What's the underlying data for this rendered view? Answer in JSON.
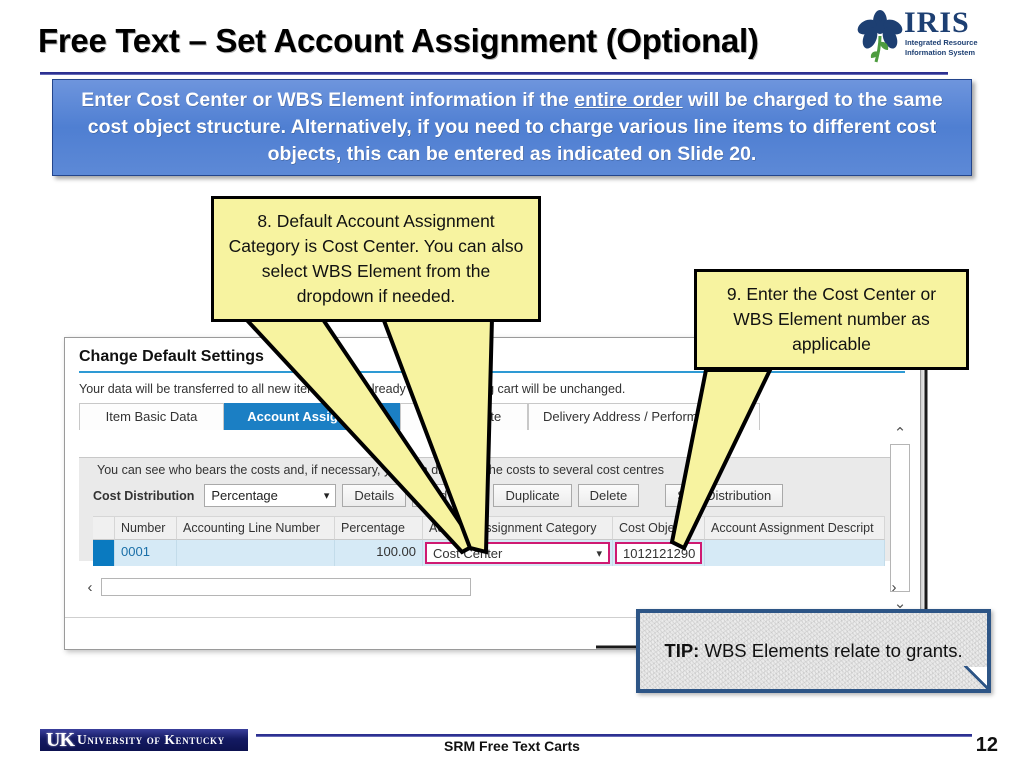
{
  "slide": {
    "title": "Free Text – Set Account Assignment (Optional)",
    "banner_text_1": "Enter Cost Center or WBS Element information if the ",
    "banner_underlined": "entire order",
    "banner_text_2": " will be charged to the same cost object structure. Alternatively, if you need to charge various line items to different cost objects, this can be entered as indicated on Slide 20."
  },
  "logo": {
    "wordmark": "IRIS",
    "subtitle": "Integrated Resource Information System",
    "icon": "iris-flower-icon"
  },
  "callouts": {
    "step8": "8. Default Account Assignment Category is Cost Center. You can also select WBS Element from the dropdown if needed.",
    "step9": "9. Enter the Cost Center or WBS Element number as applicable"
  },
  "tip": {
    "label": "TIP:",
    "text": " WBS Elements relate to grants."
  },
  "sap": {
    "heading": "Change Default Settings",
    "subtext": "Your data will be transferred to all new items. Items already in the shopping cart will be unchanged.",
    "tabs": [
      {
        "label": "Item Basic Data",
        "active": false
      },
      {
        "label": "Account Assignment",
        "active": true
      },
      {
        "label": "Internal Note",
        "active": false
      },
      {
        "label": "Delivery Address / Performance L",
        "active": false
      }
    ],
    "cost_note": "You can see who bears the costs and, if necessary, you can distribute the costs to several cost centres",
    "toolbar": {
      "cost_distribution_label": "Cost Distribution",
      "cost_distribution_value": "Percentage",
      "details_button": "Details",
      "add_line_button": "Add Line",
      "duplicate_button": "Duplicate",
      "delete_button": "Delete",
      "split_distribution_button": "Split Distribution"
    },
    "grid": {
      "headers": [
        "",
        "Number",
        "Accounting Line Number",
        "Percentage",
        "Account Assignment Category",
        "Cost Object",
        "Account Assignment Descript"
      ],
      "row": {
        "number": "0001",
        "accounting_line_number": "",
        "percentage": "100.00",
        "account_assignment_category": "Cost Center",
        "cost_object": "1012121290",
        "account_assignment_description": ""
      }
    },
    "scroll": {
      "up_arrow": "⌃",
      "down_arrow": "⌄",
      "left_chevron": "‹",
      "right_chevron": "›"
    }
  },
  "footer": {
    "uk_mark": "UK",
    "university": "University of Kentucky",
    "center_text": "SRM Free Text Carts",
    "page_number": "12"
  },
  "colors": {
    "accent_blue": "#2b2f8f",
    "banner_blue": "#4f7fd2",
    "tab_active": "#1b7fc4",
    "highlight_magenta": "#cf1a72",
    "callout_yellow": "#f7f3a0"
  }
}
